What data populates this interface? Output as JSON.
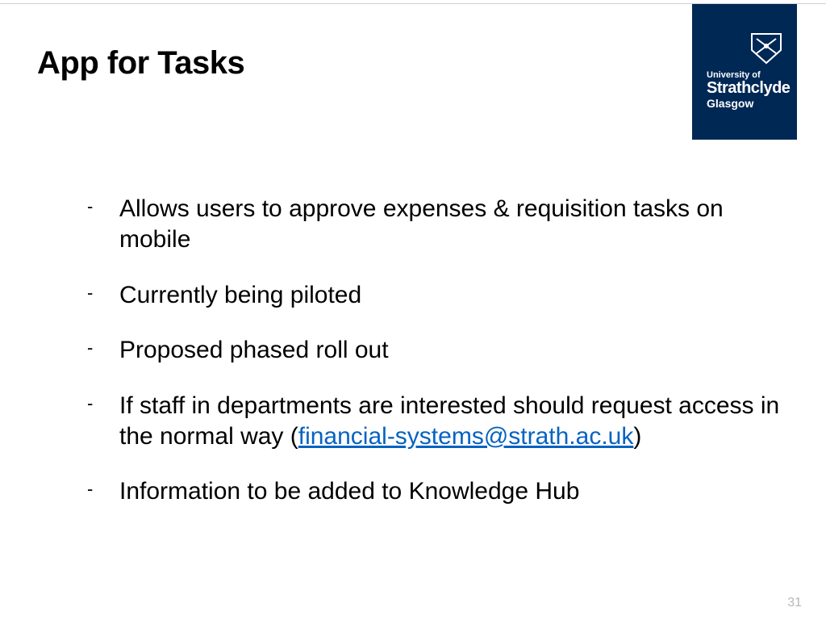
{
  "title": "App for Tasks",
  "logo": {
    "line1": "University of",
    "line2": "Strathclyde",
    "line3": "Glasgow"
  },
  "bullets": [
    {
      "text": "Allows users to approve expenses & requisition tasks on mobile"
    },
    {
      "text": "Currently being piloted"
    },
    {
      "text": "Proposed phased roll out"
    },
    {
      "pre": "If staff in departments are interested should request access in the normal way (",
      "link": "financial-systems@strath.ac.uk",
      "post": ")"
    },
    {
      "text": "Information to be added to Knowledge Hub"
    }
  ],
  "page_number": "31"
}
